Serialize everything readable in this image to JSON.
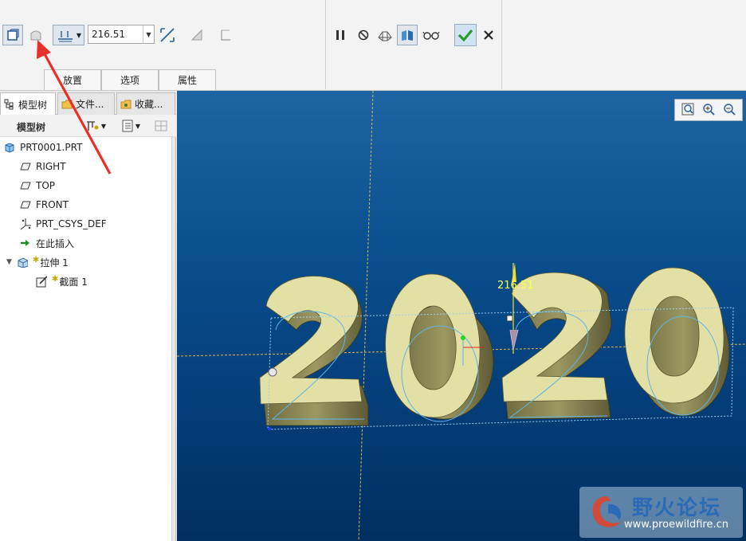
{
  "dashboard": {
    "depth_value": "216.51",
    "subtabs": [
      {
        "label": "放置"
      },
      {
        "label": "选项"
      },
      {
        "label": "属性"
      }
    ]
  },
  "left_panel": {
    "tabs": [
      {
        "label": "模型树"
      },
      {
        "label": "文件..."
      },
      {
        "label": "收藏..."
      }
    ],
    "toolbar_title": "模型树",
    "tree": [
      {
        "label": "PRT0001.PRT",
        "icon": "part-icon"
      },
      {
        "label": "RIGHT",
        "icon": "datum-plane-icon"
      },
      {
        "label": "TOP",
        "icon": "datum-plane-icon"
      },
      {
        "label": "FRONT",
        "icon": "datum-plane-icon"
      },
      {
        "label": "PRT_CSYS_DEF",
        "icon": "csys-icon"
      },
      {
        "label": "在此插入",
        "icon": "insert-here-icon"
      },
      {
        "label": "拉伸 1",
        "icon": "extrude-icon"
      },
      {
        "label": "截面 1",
        "icon": "sketch-icon"
      }
    ]
  },
  "viewport": {
    "dimension_label": "216.51",
    "model_text": "2020"
  },
  "watermark": {
    "title": "野火论坛",
    "url": "www.proewildfire.cn"
  },
  "colors": {
    "viewport_top": "#1f64a2",
    "viewport_bottom": "#012f5f",
    "model_face": "#e3e0a6",
    "model_side": "#8b8755",
    "annotation_arrow": "#e8302a",
    "confirm_green": "#2d9a2d"
  }
}
